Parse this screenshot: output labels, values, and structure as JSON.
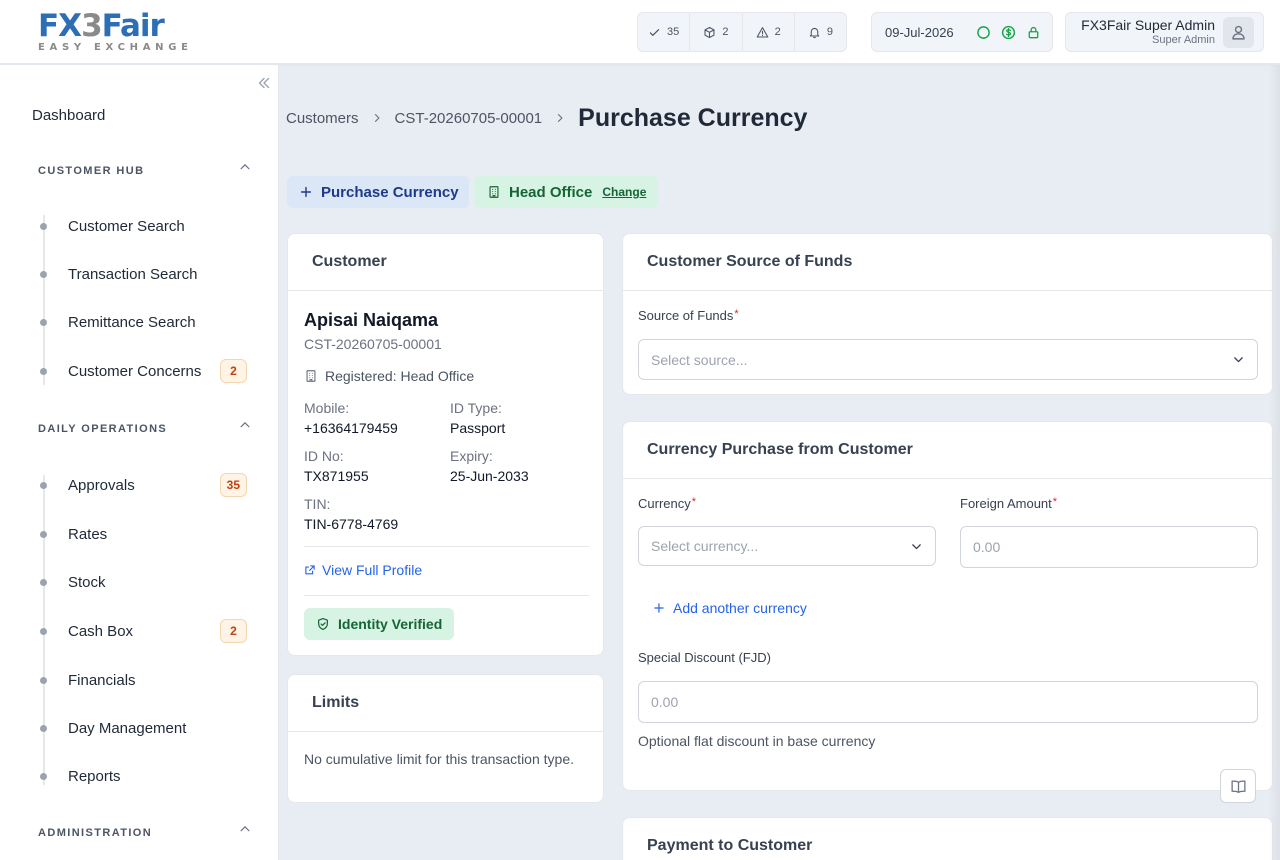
{
  "logo": {
    "main": "FX",
    "num": "3",
    "rest": "Fair",
    "sub": "EASY EXCHANGE"
  },
  "header": {
    "counters": [
      {
        "icon": "check-icon",
        "value": "35"
      },
      {
        "icon": "box-icon",
        "value": "2"
      },
      {
        "icon": "warning-icon",
        "value": "2"
      },
      {
        "icon": "bell-icon",
        "value": "9"
      }
    ],
    "date": "09-Jul-2026",
    "user_name": "FX3Fair Super Admin",
    "user_role": "Super Admin"
  },
  "sidebar": {
    "dashboard": "Dashboard",
    "sections": [
      {
        "title": "CUSTOMER HUB",
        "items": [
          {
            "label": "Customer Search"
          },
          {
            "label": "Transaction Search"
          },
          {
            "label": "Remittance Search"
          },
          {
            "label": "Customer Concerns",
            "badge": "2"
          }
        ]
      },
      {
        "title": "DAILY OPERATIONS",
        "items": [
          {
            "label": "Approvals",
            "badge": "35"
          },
          {
            "label": "Rates"
          },
          {
            "label": "Stock"
          },
          {
            "label": "Cash Box",
            "badge": "2"
          },
          {
            "label": "Financials"
          },
          {
            "label": "Day Management"
          },
          {
            "label": "Reports"
          }
        ]
      },
      {
        "title": "ADMINISTRATION",
        "items": []
      }
    ]
  },
  "breadcrumb": {
    "items": [
      "Customers",
      "CST-20260705-00001"
    ],
    "title": "Purchase Currency"
  },
  "tags": {
    "purchase": "Purchase Currency",
    "office": "Head Office",
    "change": "Change"
  },
  "customer_card": {
    "heading": "Customer",
    "name": "Apisai Naiqama",
    "id": "CST-20260705-00001",
    "registered": "Registered: Head Office",
    "mobile_label": "Mobile:",
    "mobile": "+16364179459",
    "idtype_label": "ID Type:",
    "idtype": "Passport",
    "idno_label": "ID No:",
    "idno": "TX871955",
    "expiry_label": "Expiry:",
    "expiry": "25-Jun-2033",
    "tin_label": "TIN:",
    "tin": "TIN-6778-4769",
    "profile_link": "View Full Profile",
    "verified": "Identity Verified"
  },
  "limits_card": {
    "heading": "Limits",
    "text": "No cumulative limit for this transaction type."
  },
  "funds_card": {
    "heading": "Customer Source of Funds",
    "label": "Source of Funds",
    "placeholder": "Select source..."
  },
  "purchase_card": {
    "heading": "Currency Purchase from Customer",
    "currency_label": "Currency",
    "currency_placeholder": "Select currency...",
    "amount_label": "Foreign Amount",
    "amount_placeholder": "0.00",
    "add_currency": "Add another currency",
    "discount_label": "Special Discount (FJD)",
    "discount_placeholder": "0.00",
    "discount_help": "Optional flat discount in base currency"
  },
  "payment_card": {
    "heading": "Payment to Customer"
  },
  "colors": {
    "brand": "#2d6fb6",
    "accent": "#2563eb",
    "success": "#166534",
    "warning": "#c2410c"
  }
}
